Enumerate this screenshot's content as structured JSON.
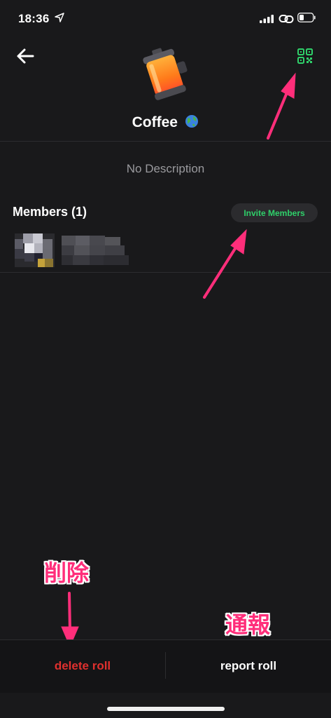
{
  "status_bar": {
    "time": "18:36"
  },
  "header": {
    "roll_name": "Coffee"
  },
  "description": "No Description",
  "members": {
    "label": "Members (1)",
    "invite_label": "Invite Members"
  },
  "annotations": {
    "delete_note": "削除",
    "report_note": "通報"
  },
  "actions": {
    "delete_label": "delete roll",
    "report_label": "report roll"
  },
  "colors": {
    "background": "#19191b",
    "accent_green": "#2fd06a",
    "delete_red": "#e0302e",
    "annotation_pink": "#ff2e7a"
  }
}
